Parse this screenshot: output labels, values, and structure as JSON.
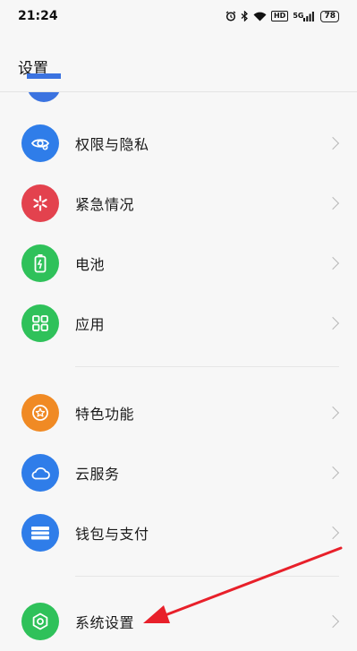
{
  "status_bar": {
    "time": "21:24",
    "hd_label": "HD",
    "network_label": "5G",
    "battery": "78"
  },
  "header": {
    "title": "设置"
  },
  "items": [
    {
      "label": "权限与隐私",
      "icon": "eye-privacy-icon",
      "color": "#2f7de9"
    },
    {
      "label": "紧急情况",
      "icon": "emergency-asterisk-icon",
      "color": "#e3424e"
    },
    {
      "label": "电池",
      "icon": "battery-icon",
      "color": "#2fc15a"
    },
    {
      "label": "应用",
      "icon": "apps-grid-icon",
      "color": "#2fc15a"
    },
    {
      "label": "特色功能",
      "icon": "star-circle-icon",
      "color": "#f08a24"
    },
    {
      "label": "云服务",
      "icon": "cloud-icon",
      "color": "#2f7de9"
    },
    {
      "label": "钱包与支付",
      "icon": "wallet-icon",
      "color": "#2f7de9"
    },
    {
      "label": "系统设置",
      "icon": "hexagon-settings-icon",
      "color": "#2fc15a"
    }
  ],
  "annotation": {
    "arrow_color": "#e8202a"
  }
}
